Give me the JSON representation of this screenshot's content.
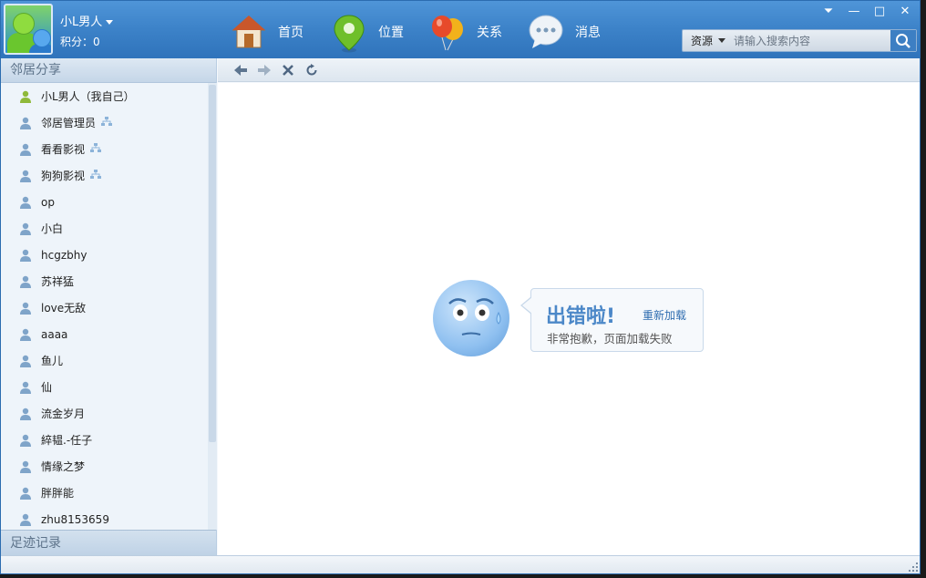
{
  "header": {
    "username": "小L男人",
    "points": "积分：0",
    "nav": [
      {
        "label": "首页",
        "icon": "home-icon"
      },
      {
        "label": "位置",
        "icon": "location-pin-icon"
      },
      {
        "label": "关系",
        "icon": "balloons-icon"
      },
      {
        "label": "消息",
        "icon": "chat-bubble-icon"
      }
    ],
    "window_buttons": [
      "⏷",
      "—",
      "□",
      "✕"
    ],
    "search": {
      "scope": "资源",
      "placeholder": "请输入搜索内容"
    }
  },
  "sidebar": {
    "section_title": "邻居分享",
    "footer_title": "足迹记录",
    "friends": [
      {
        "name": "小L男人（我自己）",
        "shared": false,
        "self": true
      },
      {
        "name": "邻居管理员",
        "shared": true,
        "self": false
      },
      {
        "name": "看看影视",
        "shared": true,
        "self": false
      },
      {
        "name": "狗狗影视",
        "shared": true,
        "self": false
      },
      {
        "name": "op",
        "shared": false,
        "self": false
      },
      {
        "name": "小白",
        "shared": false,
        "self": false
      },
      {
        "name": "hcgzbhy",
        "shared": false,
        "self": false
      },
      {
        "name": "苏祥猛",
        "shared": false,
        "self": false
      },
      {
        "name": "love无敌",
        "shared": false,
        "self": false
      },
      {
        "name": "aaaa",
        "shared": false,
        "self": false
      },
      {
        "name": "鱼儿",
        "shared": false,
        "self": false
      },
      {
        "name": "仙",
        "shared": false,
        "self": false
      },
      {
        "name": "流金岁月",
        "shared": false,
        "self": false
      },
      {
        "name": "綷韫.-任子",
        "shared": false,
        "self": false
      },
      {
        "name": "情缘之梦",
        "shared": false,
        "self": false
      },
      {
        "name": "胖胖能",
        "shared": false,
        "self": false
      },
      {
        "name": "zhu8153659",
        "shared": false,
        "self": false
      }
    ]
  },
  "toolbar": {
    "buttons": [
      "back-icon",
      "forward-icon",
      "stop-icon",
      "refresh-icon"
    ]
  },
  "error": {
    "title": "出错啦!",
    "reload": "重新加载",
    "message": "非常抱歉，页面加载失败"
  },
  "colors": {
    "header": "#3c82c8",
    "accent": "#4c88c8",
    "link": "#2f6db0"
  }
}
